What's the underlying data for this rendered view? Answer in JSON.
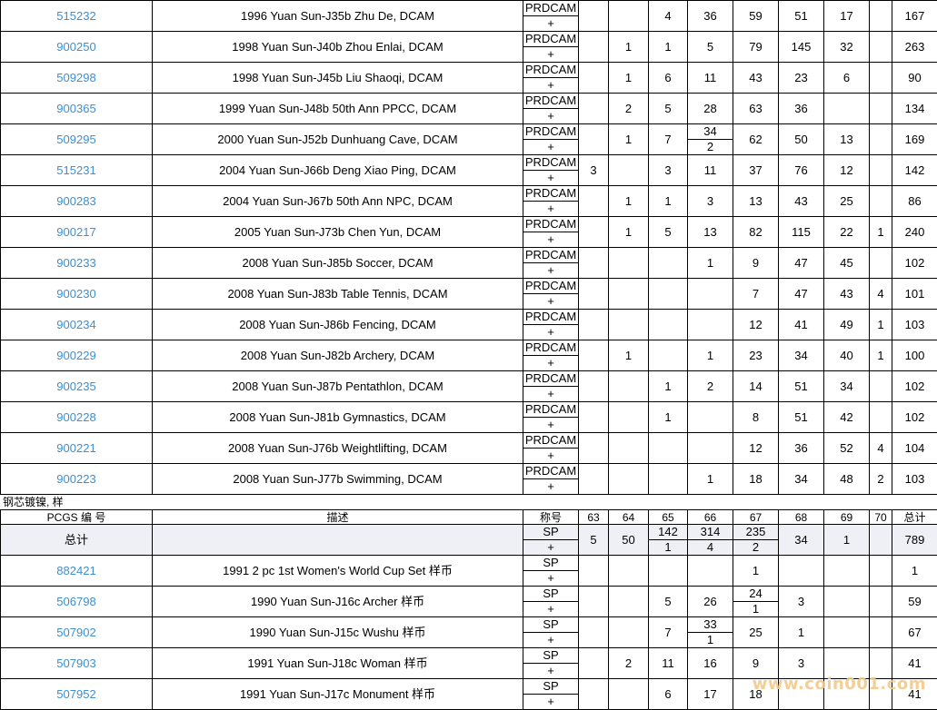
{
  "table1": {
    "rows": [
      {
        "pcgs": "515232",
        "desc": "1996 Yuan Sun-J35b Zhu De, DCAM",
        "grade_top": "PRDCAM",
        "grade_bottom": "+",
        "c63": "",
        "c64": "",
        "c65": "4",
        "c66": "36",
        "c66b": "",
        "c67": "59",
        "c67b": "",
        "c68": "51",
        "c69": "17",
        "c70": "",
        "total": "167"
      },
      {
        "pcgs": "900250",
        "desc": "1998 Yuan Sun-J40b Zhou Enlai, DCAM",
        "grade_top": "PRDCAM",
        "grade_bottom": "+",
        "c63": "",
        "c64": "1",
        "c65": "1",
        "c66": "5",
        "c66b": "",
        "c67": "79",
        "c67b": "",
        "c68": "145",
        "c69": "32",
        "c70": "",
        "total": "263"
      },
      {
        "pcgs": "509298",
        "desc": "1998 Yuan Sun-J45b Liu Shaoqi, DCAM",
        "grade_top": "PRDCAM",
        "grade_bottom": "+",
        "c63": "",
        "c64": "1",
        "c65": "6",
        "c66": "11",
        "c66b": "",
        "c67": "43",
        "c67b": "",
        "c68": "23",
        "c69": "6",
        "c70": "",
        "total": "90"
      },
      {
        "pcgs": "900365",
        "desc": "1999 Yuan Sun-J48b 50th Ann PPCC, DCAM",
        "grade_top": "PRDCAM",
        "grade_bottom": "+",
        "c63": "",
        "c64": "2",
        "c65": "5",
        "c66": "28",
        "c66b": "",
        "c67": "63",
        "c67b": "",
        "c68": "36",
        "c69": "",
        "c70": "",
        "total": "134"
      },
      {
        "pcgs": "509295",
        "desc": "2000 Yuan Sun-J52b Dunhuang Cave, DCAM",
        "grade_top": "PRDCAM",
        "grade_bottom": "+",
        "c63": "",
        "c64": "1",
        "c65": "7",
        "c66": "34",
        "c66b": "2",
        "c67": "62",
        "c67b": "",
        "c68": "50",
        "c69": "13",
        "c70": "",
        "total": "169"
      },
      {
        "pcgs": "515231",
        "desc": "2004 Yuan Sun-J66b Deng Xiao Ping, DCAM",
        "grade_top": "PRDCAM",
        "grade_bottom": "+",
        "c63": "3",
        "c64": "",
        "c65": "3",
        "c66": "11",
        "c66b": "",
        "c67": "37",
        "c67b": "",
        "c68": "76",
        "c69": "12",
        "c70": "",
        "total": "142"
      },
      {
        "pcgs": "900283",
        "desc": "2004 Yuan Sun-J67b 50th Ann NPC, DCAM",
        "grade_top": "PRDCAM",
        "grade_bottom": "+",
        "c63": "",
        "c64": "1",
        "c65": "1",
        "c66": "3",
        "c66b": "",
        "c67": "13",
        "c67b": "",
        "c68": "43",
        "c69": "25",
        "c70": "",
        "total": "86"
      },
      {
        "pcgs": "900217",
        "desc": "2005 Yuan Sun-J73b Chen Yun, DCAM",
        "grade_top": "PRDCAM",
        "grade_bottom": "+",
        "c63": "",
        "c64": "1",
        "c65": "5",
        "c66": "13",
        "c66b": "",
        "c67": "82",
        "c67b": "",
        "c68": "115",
        "c69": "22",
        "c70": "1",
        "total": "240"
      },
      {
        "pcgs": "900233",
        "desc": "2008 Yuan Sun-J85b Soccer, DCAM",
        "grade_top": "PRDCAM",
        "grade_bottom": "+",
        "c63": "",
        "c64": "",
        "c65": "",
        "c66": "1",
        "c66b": "",
        "c67": "9",
        "c67b": "",
        "c68": "47",
        "c69": "45",
        "c70": "",
        "total": "102"
      },
      {
        "pcgs": "900230",
        "desc": "2008 Yuan Sun-J83b Table Tennis, DCAM",
        "grade_top": "PRDCAM",
        "grade_bottom": "+",
        "c63": "",
        "c64": "",
        "c65": "",
        "c66": "",
        "c66b": "",
        "c67": "7",
        "c67b": "",
        "c68": "47",
        "c69": "43",
        "c70": "4",
        "total": "101"
      },
      {
        "pcgs": "900234",
        "desc": "2008 Yuan Sun-J86b Fencing, DCAM",
        "grade_top": "PRDCAM",
        "grade_bottom": "+",
        "c63": "",
        "c64": "",
        "c65": "",
        "c66": "",
        "c66b": "",
        "c67": "12",
        "c67b": "",
        "c68": "41",
        "c69": "49",
        "c70": "1",
        "total": "103"
      },
      {
        "pcgs": "900229",
        "desc": "2008 Yuan Sun-J82b Archery, DCAM",
        "grade_top": "PRDCAM",
        "grade_bottom": "+",
        "c63": "",
        "c64": "1",
        "c65": "",
        "c66": "1",
        "c66b": "",
        "c67": "23",
        "c67b": "",
        "c68": "34",
        "c69": "40",
        "c70": "1",
        "total": "100"
      },
      {
        "pcgs": "900235",
        "desc": "2008 Yuan Sun-J87b Pentathlon, DCAM",
        "grade_top": "PRDCAM",
        "grade_bottom": "+",
        "c63": "",
        "c64": "",
        "c65": "1",
        "c66": "2",
        "c66b": "",
        "c67": "14",
        "c67b": "",
        "c68": "51",
        "c69": "34",
        "c70": "",
        "total": "102"
      },
      {
        "pcgs": "900228",
        "desc": "2008 Yuan Sun-J81b Gymnastics, DCAM",
        "grade_top": "PRDCAM",
        "grade_bottom": "+",
        "c63": "",
        "c64": "",
        "c65": "1",
        "c66": "",
        "c66b": "",
        "c67": "8",
        "c67b": "",
        "c68": "51",
        "c69": "42",
        "c70": "",
        "total": "102"
      },
      {
        "pcgs": "900221",
        "desc": "2008 Yuan Sun-J76b Weightlifting, DCAM",
        "grade_top": "PRDCAM",
        "grade_bottom": "+",
        "c63": "",
        "c64": "",
        "c65": "",
        "c66": "",
        "c66b": "",
        "c67": "12",
        "c67b": "",
        "c68": "36",
        "c69": "52",
        "c70": "4",
        "total": "104"
      },
      {
        "pcgs": "900223",
        "desc": "2008 Yuan Sun-J77b Swimming, DCAM",
        "grade_top": "PRDCAM",
        "grade_bottom": "+",
        "c63": "",
        "c64": "",
        "c65": "",
        "c66": "1",
        "c66b": "",
        "c67": "18",
        "c67b": "",
        "c68": "34",
        "c69": "48",
        "c70": "2",
        "total": "103"
      }
    ]
  },
  "section2": {
    "label": "钢芯镀镍, 样",
    "headers": {
      "pcgs": "PCGS 编 号",
      "desc": "描述",
      "grade": "称号",
      "c63": "63",
      "c64": "64",
      "c65": "65",
      "c66": "66",
      "c67": "67",
      "c68": "68",
      "c69": "69",
      "c70": "70",
      "total": "总计"
    },
    "total_row": {
      "label": "总计",
      "grade_top": "SP",
      "grade_bottom": "+",
      "c63": "5",
      "c64": "50",
      "c65": "142",
      "c65b": "1",
      "c66": "314",
      "c66b": "4",
      "c67": "235",
      "c67b": "2",
      "c68": "34",
      "c69": "1",
      "c70": "",
      "total": "789"
    },
    "rows": [
      {
        "pcgs": "882421",
        "desc": "1991 2 pc 1st Women's World Cup Set 样币",
        "grade_top": "SP",
        "grade_bottom": "+",
        "c63": "",
        "c64": "",
        "c65": "",
        "c66": "",
        "c66b": "",
        "c67": "1",
        "c67b": "",
        "c68": "",
        "c69": "",
        "c70": "",
        "total": "1"
      },
      {
        "pcgs": "506798",
        "desc": "1990 Yuan Sun-J16c Archer 样币",
        "grade_top": "SP",
        "grade_bottom": "+",
        "c63": "",
        "c64": "",
        "c65": "5",
        "c66": "26",
        "c66b": "",
        "c67": "24",
        "c67b": "1",
        "c68": "3",
        "c69": "",
        "c70": "",
        "total": "59"
      },
      {
        "pcgs": "507902",
        "desc": "1990 Yuan Sun-J15c Wushu 样币",
        "grade_top": "SP",
        "grade_bottom": "+",
        "c63": "",
        "c64": "",
        "c65": "7",
        "c66": "33",
        "c66b": "1",
        "c67": "25",
        "c67b": "",
        "c68": "1",
        "c69": "",
        "c70": "",
        "total": "67"
      },
      {
        "pcgs": "507903",
        "desc": "1991 Yuan Sun-J18c Woman 样币",
        "grade_top": "SP",
        "grade_bottom": "+",
        "c63": "",
        "c64": "2",
        "c65": "11",
        "c66": "16",
        "c66b": "",
        "c67": "9",
        "c67b": "",
        "c68": "3",
        "c69": "",
        "c70": "",
        "total": "41"
      },
      {
        "pcgs": "507952",
        "desc": "1991 Yuan Sun-J17c Monument 样币",
        "grade_top": "SP",
        "grade_bottom": "+",
        "c63": "",
        "c64": "",
        "c65": "6",
        "c66": "17",
        "c66b": "",
        "c67": "18",
        "c67b": "",
        "c68": "",
        "c69": "",
        "c70": "",
        "total": "41"
      }
    ]
  },
  "watermark": "www.coin001.com",
  "colors": {
    "link": "#3d8fd1",
    "header_bg": "#eef0f6",
    "watermark": "#f2c98a"
  }
}
